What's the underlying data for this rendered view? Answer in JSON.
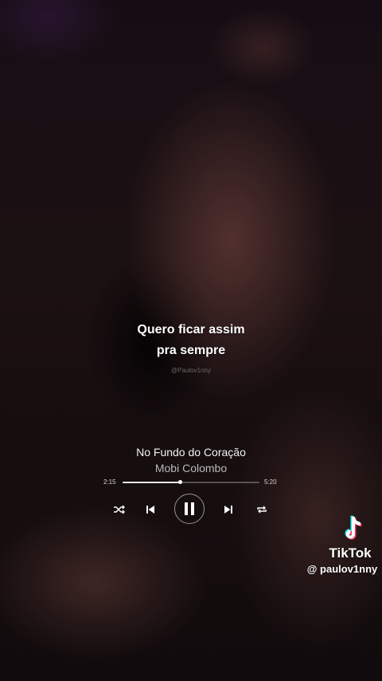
{
  "lyrics": {
    "line1": "Quero ficar assim",
    "line2": "pra sempre",
    "credit": "@Paulov1nny"
  },
  "player": {
    "title": "No Fundo do Coração",
    "artist": "Mobi Colombo",
    "elapsed": "2:15",
    "total": "5:20",
    "progress_fraction": 0.42,
    "controls": {
      "shuffle_icon": "shuffle-icon",
      "prev_icon": "skip-previous-icon",
      "playpause_icon": "pause-icon",
      "next_icon": "skip-next-icon",
      "repeat_icon": "repeat-icon"
    }
  },
  "watermark": {
    "brand": "TikTok",
    "handle": "@ paulov1nny",
    "colors": {
      "cyan": "#25F4EE",
      "red": "#FE2C55",
      "white": "#FFFFFF"
    }
  }
}
